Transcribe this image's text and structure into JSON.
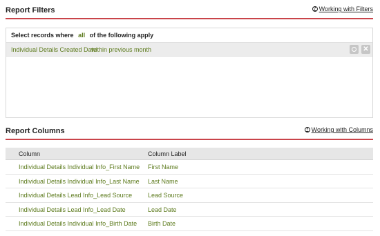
{
  "filters": {
    "title": "Report Filters",
    "help_link": "Working with Filters",
    "caption_prefix": "Select records where",
    "caption_mode": "all",
    "caption_suffix": "of the following apply",
    "rows": [
      {
        "field": "Individual Details Created Date",
        "operator": "within previous month"
      }
    ]
  },
  "columns": {
    "title": "Report Columns",
    "help_link": "Working with Columns",
    "headers": {
      "column": "Column",
      "label": "Column Label"
    },
    "rows": [
      {
        "column": "Individual Details Individual Info_First Name",
        "label": "First Name"
      },
      {
        "column": "Individual Details Individual Info_Last Name",
        "label": "Last Name"
      },
      {
        "column": "Individual Details Lead Info_Lead Source",
        "label": "Lead Source"
      },
      {
        "column": "Individual Details Lead Info_Lead Date",
        "label": "Lead Date"
      },
      {
        "column": "Individual Details Individual Info_Birth Date",
        "label": "Birth Date"
      }
    ]
  },
  "colors": {
    "accent_rule": "#c9444a",
    "value_green": "#5c7a1c",
    "row_button": "#c6c6c6"
  },
  "icons": {
    "help": "help-circle-icon",
    "settings": "settings-icon",
    "delete": "close-icon"
  }
}
